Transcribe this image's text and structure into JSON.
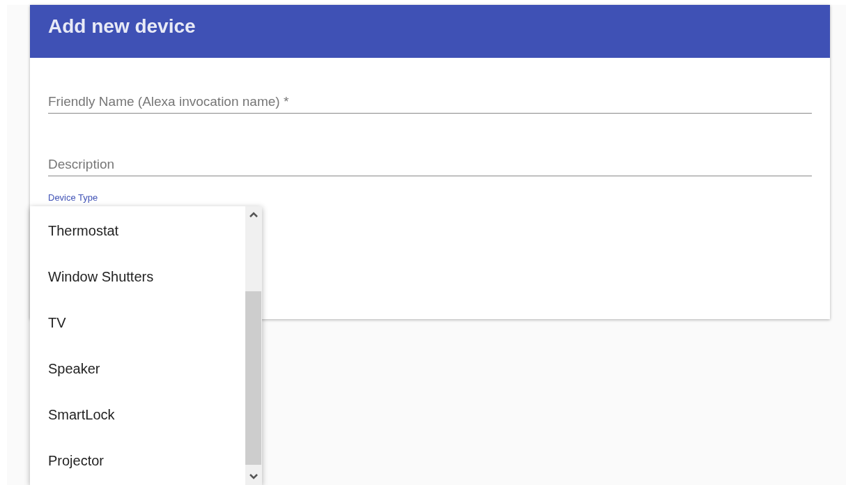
{
  "dialog": {
    "title": "Add new device"
  },
  "fields": [
    {
      "placeholder": "Friendly Name (Alexa invocation name) *"
    },
    {
      "placeholder": "Description"
    }
  ],
  "device_type": {
    "label": "Device Type",
    "options": [
      "Thermostat",
      "Window Shutters",
      "TV",
      "Speaker",
      "SmartLock",
      "Projector"
    ]
  }
}
